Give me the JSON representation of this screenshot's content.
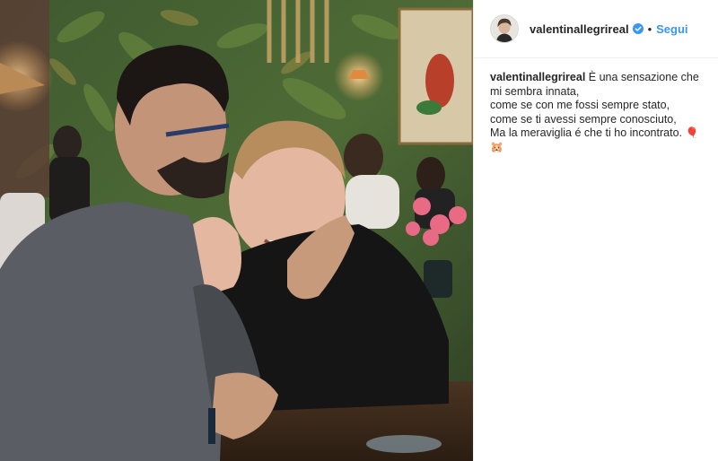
{
  "post": {
    "username": "valentinallegrireal",
    "verified": true,
    "separator": "•",
    "follow_label": "Segui"
  },
  "caption": {
    "username": "valentinallegrireal",
    "line1": " È una sensazione che mi sembra innata,",
    "line2": "come se con me fossi sempre stato,",
    "line3": "come se ti avessi sempre conosciuto,",
    "line4": "Ma la meraviglia é che ti ho incontrato. ",
    "emoji1": "🎈",
    "emoji2": "🐹"
  },
  "icons": {
    "verified": "verified-badge-icon",
    "balloon": "balloon-emoji",
    "hamster": "hamster-emoji"
  },
  "colors": {
    "link": "#3897f0",
    "text": "#262626",
    "border": "#efefef"
  }
}
